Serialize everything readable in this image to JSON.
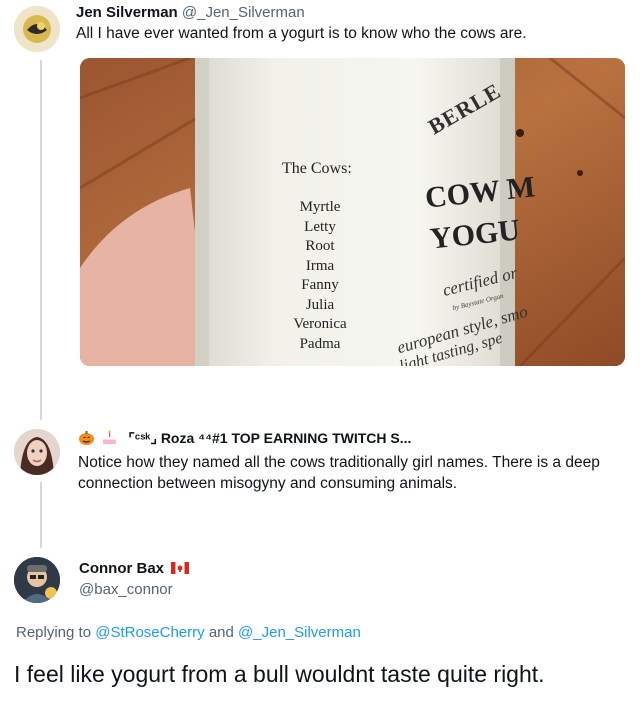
{
  "colors": {
    "link": "#1d9bf0",
    "muted": "#536471",
    "text": "#0f1419",
    "thread_line": "#cfd9de"
  },
  "tweet1": {
    "avatar_icon": "user-avatar-icon",
    "name": "Jen Silverman",
    "handle": "@_Jen_Silverman",
    "text": "All I have ever wanted from a yogurt is to know who the cows are.",
    "photo": {
      "heading": "The Cows:",
      "cows": [
        "Myrtle",
        "Letty",
        "Root",
        "Irma",
        "Fanny",
        "Julia",
        "Veronica",
        "Padma"
      ],
      "brand_top": "BERLE",
      "brand_cow": "COW M",
      "brand_yog": "YOGU",
      "certified": "certified or",
      "by_line": "by Baystate Organ",
      "european": "european style, smo",
      "light": "light tasting, spe"
    }
  },
  "tweet2": {
    "avatar_icon": "user-avatar-icon",
    "badge_icons": [
      "pumpkin-emoji-icon",
      "cake-emoji-icon"
    ],
    "name": "⌜ᶜˢᵏ⌟ Roza ⁴⁴#1 TOP EARNING TWITCH S...",
    "text": "Notice how they named all the cows traditionally girl names. There is a deep connection between misogyny and consuming animals."
  },
  "tweet3": {
    "avatar_icon": "user-avatar-icon",
    "name": "Connor Bax",
    "flag_icon": "canada-flag-icon",
    "handle": "@bax_connor",
    "replying_prefix": "Replying to",
    "reply_user1": "@StRoseCherry",
    "reply_and": "and",
    "reply_user2": "@_Jen_Silverman",
    "text": "I feel like yogurt from a bull wouldnt taste quite right."
  }
}
